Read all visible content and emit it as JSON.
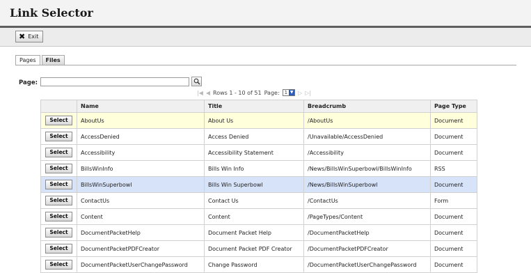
{
  "window": {
    "title": "Link Selector"
  },
  "toolbar": {
    "exit_label": "Exit"
  },
  "tabs": [
    {
      "label": "Pages",
      "active": true
    },
    {
      "label": "Files",
      "active": false
    }
  ],
  "search": {
    "label": "Page:",
    "value": ""
  },
  "pager": {
    "rows_text": "Rows 1 - 10 of 51",
    "page_label": "Page:",
    "current_page": "1"
  },
  "table": {
    "columns": [
      "",
      "Name",
      "Title",
      "Breadcrumb",
      "Page Type"
    ],
    "select_label": "Select",
    "rows": [
      {
        "name": "AboutUs",
        "title": "About Us",
        "breadcrumb": "/AboutUs",
        "type": "Document",
        "highlight": "yellow"
      },
      {
        "name": "AccessDenied",
        "title": "Access Denied",
        "breadcrumb": "/Unavailable/AccessDenied",
        "type": "Document",
        "highlight": ""
      },
      {
        "name": "Accessibility",
        "title": "Accessibility Statement",
        "breadcrumb": "/Accessibility",
        "type": "Document",
        "highlight": ""
      },
      {
        "name": "BillsWinInfo",
        "title": "Bills Win Info",
        "breadcrumb": "/News/BillsWinSuperbowl/BillsWinInfo",
        "type": "RSS",
        "highlight": ""
      },
      {
        "name": "BillsWinSuperbowl",
        "title": "Bills Win Superbowl",
        "breadcrumb": "/News/BillsWinSuperbowl",
        "type": "Document",
        "highlight": "blue"
      },
      {
        "name": "ContactUs",
        "title": "Contact Us",
        "breadcrumb": "/ContactUs",
        "type": "Form",
        "highlight": ""
      },
      {
        "name": "Content",
        "title": "Content",
        "breadcrumb": "/PageTypes/Content",
        "type": "Document",
        "highlight": ""
      },
      {
        "name": "DocumentPacketHelp",
        "title": "Document Packet Help",
        "breadcrumb": "/DocumentPacketHelp",
        "type": "Document",
        "highlight": ""
      },
      {
        "name": "DocumentPacketPDFCreator",
        "title": "Document Packet PDF Creator",
        "breadcrumb": "/DocumentPacketPDFCreator",
        "type": "Document",
        "highlight": ""
      },
      {
        "name": "DocumentPacketUserChangePassword",
        "title": "Change Password",
        "breadcrumb": "/DocumentPacketUserChangePassword",
        "type": "Document",
        "highlight": ""
      }
    ]
  },
  "colors": {
    "highlight_yellow": "#ffffdc",
    "highlight_blue": "#d6e3f9",
    "titlebar_rule": "#5f5f5f"
  },
  "icons": {
    "exit": "close-icon",
    "search": "search-icon",
    "first": "first-page-icon",
    "prev": "prev-page-icon",
    "next": "next-page-icon",
    "last": "last-page-icon",
    "dropdown": "chevron-down-icon"
  }
}
